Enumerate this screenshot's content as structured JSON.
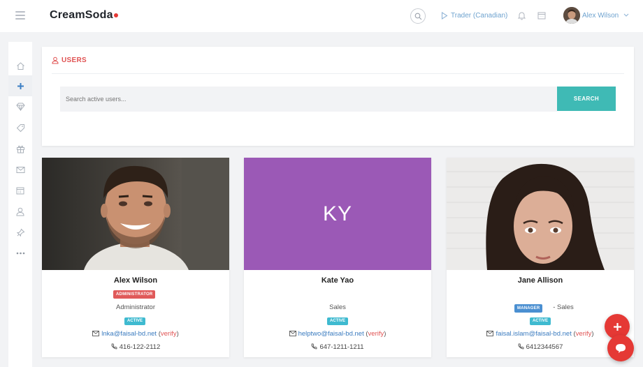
{
  "header": {
    "brand": "CreamSoda",
    "mode_label": "Trader (Canadian)",
    "user_name": "Alex Wilson"
  },
  "sidebar": {
    "items": [
      {
        "icon": "home-icon"
      },
      {
        "icon": "plus-icon",
        "active": true
      },
      {
        "icon": "diamond-icon"
      },
      {
        "icon": "tag-icon"
      },
      {
        "icon": "gift-icon"
      },
      {
        "icon": "mail-icon"
      },
      {
        "icon": "calendar-icon"
      },
      {
        "icon": "user-icon"
      },
      {
        "icon": "pin-icon"
      },
      {
        "icon": "more-icon"
      }
    ]
  },
  "users_panel": {
    "title": "USERS",
    "search_placeholder": "Search active users...",
    "search_button": "SEARCH"
  },
  "cards": [
    {
      "name": "Alex Wilson",
      "badge": "ADMINISTRATOR",
      "role": "Administrator",
      "status": "ACTIVE",
      "email": "lnka@faisal-bd.net",
      "verify": "verify",
      "phone": "416-122-2112"
    },
    {
      "name": "Kate Yao",
      "initials": "KY",
      "role": "Sales",
      "status": "ACTIVE",
      "email": "helptwo@faisal-bd.net",
      "verify": "verify",
      "phone": "647-1211-1211"
    },
    {
      "name": "Jane Allison",
      "badge": "MANAGER",
      "role": "- Sales",
      "status": "ACTIVE",
      "email": "faisal.islam@faisal-bd.net",
      "verify": "verify",
      "phone": "6412344567"
    }
  ],
  "colors": {
    "accent": "#3fbab5",
    "brand_red": "#e53935",
    "link_blue": "#3a7bbf",
    "initials_bg": "#9b59b6"
  }
}
